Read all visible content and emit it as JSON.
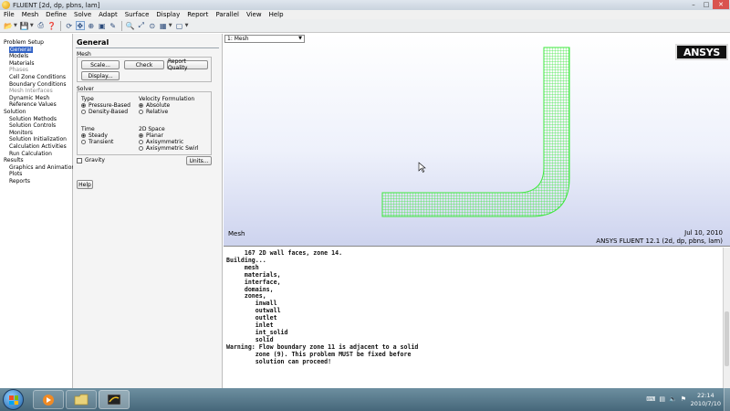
{
  "window": {
    "title": "FLUENT  [2d, dp, pbns, lam]"
  },
  "menu": [
    "File",
    "Mesh",
    "Define",
    "Solve",
    "Adapt",
    "Surface",
    "Display",
    "Report",
    "Parallel",
    "View",
    "Help"
  ],
  "navigation": {
    "items": [
      {
        "label": "Problem Setup",
        "level": 0
      },
      {
        "label": "General",
        "level": 1,
        "selected": true
      },
      {
        "label": "Models",
        "level": 1
      },
      {
        "label": "Materials",
        "level": 1
      },
      {
        "label": "Phases",
        "level": 1,
        "disabled": true
      },
      {
        "label": "Cell Zone Conditions",
        "level": 1
      },
      {
        "label": "Boundary Conditions",
        "level": 1
      },
      {
        "label": "Mesh Interfaces",
        "level": 1,
        "disabled": true
      },
      {
        "label": "Dynamic Mesh",
        "level": 1
      },
      {
        "label": "Reference Values",
        "level": 1
      },
      {
        "label": "Solution",
        "level": 0
      },
      {
        "label": "Solution Methods",
        "level": 1
      },
      {
        "label": "Solution Controls",
        "level": 1
      },
      {
        "label": "Monitors",
        "level": 1
      },
      {
        "label": "Solution Initialization",
        "level": 1
      },
      {
        "label": "Calculation Activities",
        "level": 1
      },
      {
        "label": "Run Calculation",
        "level": 1
      },
      {
        "label": "Results",
        "level": 0
      },
      {
        "label": "Graphics and Animations",
        "level": 1
      },
      {
        "label": "Plots",
        "level": 1
      },
      {
        "label": "Reports",
        "level": 1
      }
    ]
  },
  "general_panel": {
    "title": "General",
    "mesh_label": "Mesh",
    "buttons": {
      "scale": "Scale...",
      "check": "Check",
      "report_quality": "Report Quality",
      "display": "Display...",
      "units": "Units...",
      "help": "Help"
    },
    "solver_label": "Solver",
    "type_label": "Type",
    "type_options": [
      {
        "label": "Pressure-Based",
        "checked": true
      },
      {
        "label": "Density-Based",
        "checked": false
      }
    ],
    "velocity_label": "Velocity Formulation",
    "velocity_options": [
      {
        "label": "Absolute",
        "checked": true
      },
      {
        "label": "Relative",
        "checked": false
      }
    ],
    "time_label": "Time",
    "time_options": [
      {
        "label": "Steady",
        "checked": true
      },
      {
        "label": "Transient",
        "checked": false
      }
    ],
    "space_label": "2D Space",
    "space_options": [
      {
        "label": "Planar",
        "checked": true
      },
      {
        "label": "Axisymmetric",
        "checked": false
      },
      {
        "label": "Axisymmetric Swirl",
        "checked": false
      }
    ],
    "gravity_label": "Gravity",
    "gravity_checked": false
  },
  "graphics": {
    "view_select": "1: Mesh",
    "logo": "ANSYS",
    "bottom_left": "Mesh",
    "date": "Jul 10, 2010",
    "version": "ANSYS FLUENT 12.1 (2d, dp, pbns, lam)",
    "mesh_color": "#3ee83e"
  },
  "console": {
    "lines": [
      "     167 2D wall faces, zone 14.",
      "",
      "Building...",
      "     mesh",
      "     materials,",
      "     interface,",
      "     domains,",
      "     zones,",
      "        inwall",
      "        outwall",
      "        outlet",
      "        inlet",
      "        int_solid",
      "        solid",
      "Warning: Flow boundary zone 11 is adjacent to a solid",
      "        zone (9). This problem MUST be fixed before",
      "        solution can proceed!"
    ]
  },
  "taskbar": {
    "apps": [
      "media-player",
      "file-explorer",
      "fluent"
    ],
    "time": "22:14",
    "date": "2010/7/10",
    "tray_icons": [
      "keyboard-icon",
      "network-icon",
      "volume-icon",
      "flag-icon"
    ]
  }
}
